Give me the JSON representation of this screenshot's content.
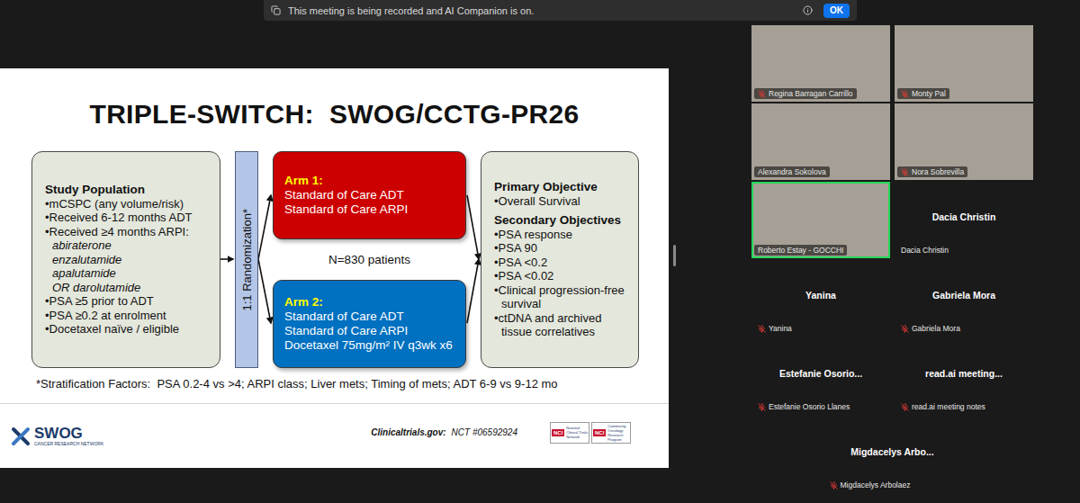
{
  "notification": {
    "text": "This meeting is being recorded and AI Companion is on.",
    "button": "OK"
  },
  "slide": {
    "title": "TRIPLE-SWITCH:  SWOG/CCTG-PR26",
    "population": {
      "heading": "Study Population",
      "items": [
        {
          "text": "•mCSPC (any volume/risk)",
          "kind": "bullet"
        },
        {
          "text": "•Received 6-12 months ADT",
          "kind": "bullet"
        },
        {
          "text": "•Received ≥4 months ARPI:",
          "kind": "bullet"
        },
        {
          "text": "abiraterone",
          "kind": "sub"
        },
        {
          "text": "enzalutamide",
          "kind": "sub"
        },
        {
          "text": "apalutamide",
          "kind": "sub"
        },
        {
          "text": "OR darolutamide",
          "kind": "sub"
        },
        {
          "text": "•PSA ≥5 prior to ADT",
          "kind": "bullet"
        },
        {
          "text": "•PSA ≥0.2 at enrolment",
          "kind": "bullet"
        },
        {
          "text": "•Docetaxel naïve / eligible",
          "kind": "bullet"
        }
      ]
    },
    "randomization": "1:1 Randomization*",
    "arms": [
      {
        "title": "Arm 1:",
        "lines": [
          "Standard of Care ADT",
          "Standard of Care ARPI"
        ],
        "color": "#cc0000"
      },
      {
        "title": "Arm 2:",
        "lines": [
          "Standard of Care ADT",
          "Standard of Care ARPI",
          "Docetaxel 75mg/m² IV q3wk x6"
        ],
        "color": "#0070c0"
      }
    ],
    "n": "N=830 patients",
    "objectives": {
      "primary_heading": "Primary Objective",
      "primary": [
        "•Overall Survival"
      ],
      "secondary_heading": "Secondary Objectives",
      "secondary": [
        "•PSA response",
        "•PSA 90",
        "•PSA <0.2",
        "•PSA <0.02",
        "•Clinical progression-free survival",
        "•ctDNA and archived tissue correlatives"
      ]
    },
    "stratification": "*Stratification Factors:  PSA 0.2-4 vs >4; ARPI class; Liver mets; Timing of mets; ADT 6-9 vs 9-12 mo",
    "logo": {
      "name": "SWOG",
      "tagline": "CANCER RESEARCH NETWORK"
    },
    "registry": {
      "label": "Clinicaltrials.gov:",
      "id": "NCT #06592924"
    },
    "nci_badges": [
      {
        "mark": "NCI",
        "text": "National Clinical Trials Network"
      },
      {
        "mark": "NCI",
        "text": "Community Oncology Research Program"
      }
    ]
  },
  "participants": [
    {
      "label": "Regina Barragan Carrillo",
      "video": true,
      "muted": true,
      "active": false
    },
    {
      "label": "Monty Pal",
      "video": true,
      "muted": true,
      "active": false
    },
    {
      "label": "Alexandra Sokolova",
      "video": true,
      "muted": false,
      "active": false
    },
    {
      "label": "Nora Sobrevilla",
      "video": true,
      "muted": true,
      "active": false
    },
    {
      "label": "Roberto Estay - GOCCHI",
      "video": true,
      "muted": false,
      "active": true
    },
    {
      "title": "Dacia Christin",
      "label": "Dacia Christin",
      "video": false,
      "muted": false,
      "active": false
    },
    {
      "title": "Yanina",
      "label": "Yanina",
      "video": false,
      "muted": true,
      "active": false
    },
    {
      "title": "Gabriela Mora",
      "label": "Gabriela Mora",
      "video": false,
      "muted": true,
      "active": false
    },
    {
      "title": "Estefanie Osorio...",
      "label": "Estefanie Osorio Llanes",
      "video": false,
      "muted": true,
      "active": false
    },
    {
      "title": "read.ai meeting...",
      "label": "read.ai meeting notes",
      "video": false,
      "muted": true,
      "active": false
    },
    {
      "title": "Migdacelys Arbo...",
      "label": "Migdacelys Arbolaez",
      "video": false,
      "muted": true,
      "active": false
    }
  ]
}
